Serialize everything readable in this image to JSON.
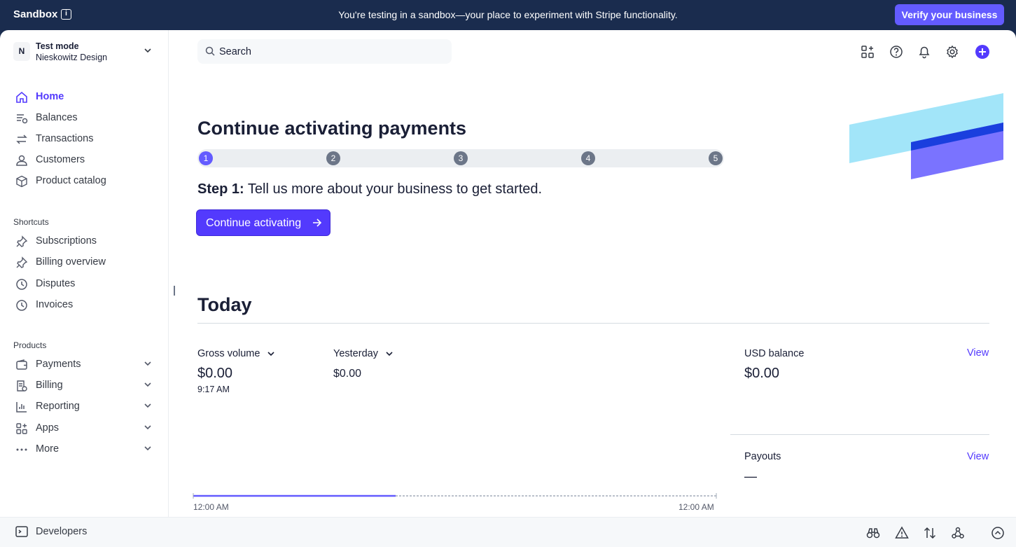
{
  "banner": {
    "sandbox_label": "Sandbox",
    "info_icon": "info-icon",
    "message": "You're testing in a sandbox—your place to experiment with Stripe functionality.",
    "verify_button": "Verify your business"
  },
  "account": {
    "avatar_letter": "N",
    "mode": "Test mode",
    "org": "Nieskowitz Design"
  },
  "nav": {
    "main": [
      {
        "label": "Home",
        "icon": "home-icon",
        "active": true
      },
      {
        "label": "Balances",
        "icon": "balances-icon"
      },
      {
        "label": "Transactions",
        "icon": "transactions-icon"
      },
      {
        "label": "Customers",
        "icon": "customers-icon"
      },
      {
        "label": "Product catalog",
        "icon": "product-catalog-icon"
      }
    ],
    "shortcuts_title": "Shortcuts",
    "shortcuts": [
      {
        "label": "Subscriptions",
        "icon": "pin-icon"
      },
      {
        "label": "Billing overview",
        "icon": "pin-icon"
      },
      {
        "label": "Disputes",
        "icon": "clock-icon"
      },
      {
        "label": "Invoices",
        "icon": "clock-icon"
      }
    ],
    "products_title": "Products",
    "products": [
      {
        "label": "Payments",
        "icon": "wallet-icon"
      },
      {
        "label": "Billing",
        "icon": "billing-icon"
      },
      {
        "label": "Reporting",
        "icon": "reporting-icon"
      },
      {
        "label": "Apps",
        "icon": "apps-icon"
      },
      {
        "label": "More",
        "icon": "more-icon"
      }
    ]
  },
  "devbar": {
    "developers_label": "Developers",
    "icons": [
      "binoculars-icon",
      "warning-icon",
      "sort-arrows-icon",
      "webhooks-icon",
      "chevron-up-icon"
    ]
  },
  "header": {
    "search_placeholder": "Search",
    "icons": [
      "apps-grid-icon",
      "help-icon",
      "bell-icon",
      "gear-icon",
      "plus-icon"
    ]
  },
  "activation": {
    "title": "Continue activating payments",
    "steps": [
      "1",
      "2",
      "3",
      "4",
      "5"
    ],
    "current_step": 1,
    "step_prefix": "Step 1:",
    "step_text": " Tell us more about your business to get started.",
    "cta_label": "Continue activating"
  },
  "today": {
    "title": "Today",
    "gross_volume_label": "Gross volume",
    "gross_volume_value": "$0.00",
    "gross_volume_time": "9:17 AM",
    "compare_label": "Yesterday",
    "compare_value": "$0.00",
    "axis_start": "12:00 AM",
    "axis_end": "12:00 AM",
    "usd_balance_label": "USD balance",
    "usd_balance_value": "$0.00",
    "payouts_label": "Payouts",
    "payouts_value": "—",
    "view_label": "View"
  },
  "colors": {
    "accent": "#533afd",
    "banner_bg": "#1a2c4e"
  }
}
